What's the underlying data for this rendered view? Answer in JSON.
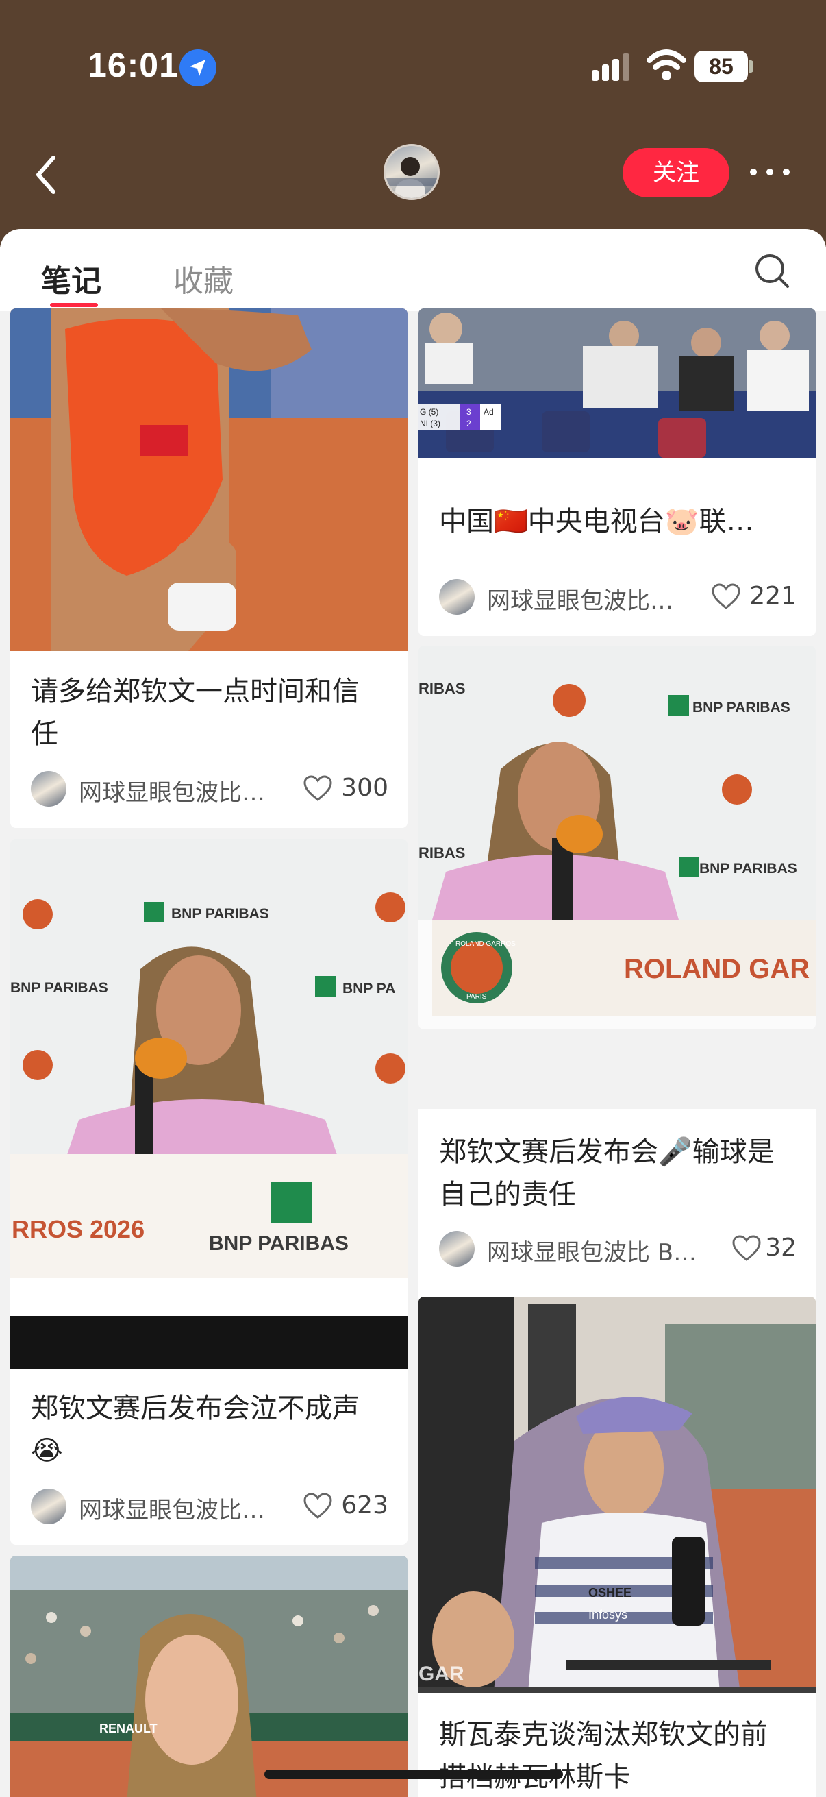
{
  "status_bar": {
    "time": "16:01",
    "battery": "85"
  },
  "header": {
    "follow_label": "关注"
  },
  "tabs": [
    {
      "label": "笔记"
    },
    {
      "label": "收藏"
    }
  ],
  "notes": [
    {
      "title": "",
      "author": "",
      "likes": ""
    },
    {
      "title": "中国🇨🇳中央电视台🐷联…",
      "author": "网球显眼包波比…",
      "likes": "221",
      "image_text": [
        "G (5)",
        "NI (3)",
        "3",
        "2",
        "Ad"
      ]
    },
    {
      "title": "请多给郑钦文一点时间和信\n任",
      "author": "网球显眼包波比…",
      "likes": "300"
    },
    {
      "title": "郑钦文赛后发布会🎤输球是\n自己的责任",
      "author": "网球显眼包波比 B…",
      "likes": "32",
      "image_text": [
        "RIBAS",
        "BNP PARIBAS",
        "BNP PARIBAS",
        "RIBAS",
        "ROLAND GAR",
        "ROLAND GARROS",
        "PARIS"
      ]
    },
    {
      "title": "郑钦文赛后发布会泣不成声\n😭",
      "author": "网球显眼包波比…",
      "likes": "623",
      "image_text": [
        "BNP PARIBAS",
        "BNP PARIBAS",
        "BNP PA",
        "RROS 2026",
        "BNP PARIBAS"
      ]
    },
    {
      "title": "斯瓦泰克谈淘汰郑钦文的前\n搭档赫瓦林斯卡",
      "author": "",
      "likes": "",
      "image_text": [
        "OSHEE",
        "Infosys",
        "GAR"
      ]
    },
    {
      "title": "",
      "author": "",
      "likes": "",
      "image_text": [
        "RENAULT"
      ]
    }
  ]
}
